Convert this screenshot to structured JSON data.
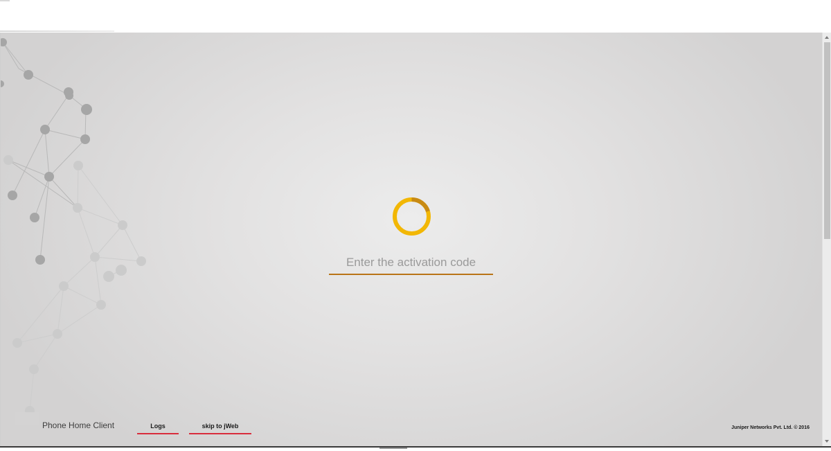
{
  "activation": {
    "placeholder": "Enter the activation code"
  },
  "footer": {
    "brand": "Phone Home Client",
    "links": {
      "logs": "Logs",
      "skip": "skip to jWeb"
    },
    "copyright": "Juniper Networks Pvt. Ltd. © 2016"
  },
  "colors": {
    "spinner_ring": "#f2b705",
    "spinner_arc": "#c88a13",
    "input_underline": "#b97417",
    "link_underline": "#d92c3c"
  },
  "icons": {
    "spinner": "loading-spinner-icon",
    "network": "network-graph-decoration"
  }
}
